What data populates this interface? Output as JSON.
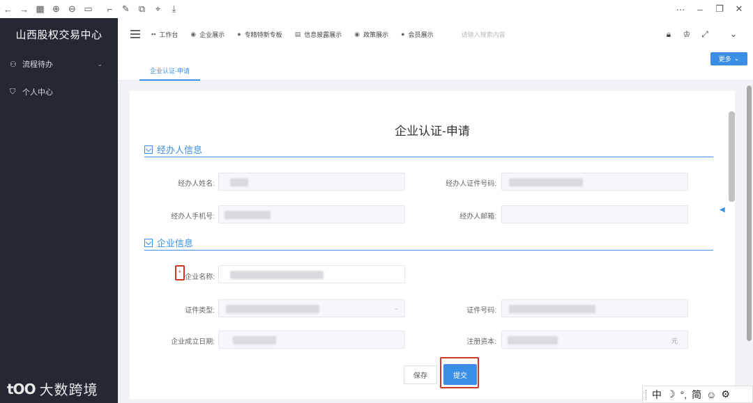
{
  "browser": {
    "icons": [
      "back-icon",
      "forward-icon",
      "apps-icon",
      "zoom-in-icon",
      "zoom-out-icon",
      "fit-icon",
      "crop-icon",
      "edit-icon",
      "copy-icon",
      "screenshot-icon",
      "download-icon"
    ],
    "right_icons": [
      "more-icon",
      "minimize-icon",
      "restore-icon",
      "close-icon"
    ]
  },
  "sidebar": {
    "brand": "山西股权交易中心",
    "items": [
      {
        "label": "流程待办",
        "icon": "flow-icon",
        "has_children": true
      },
      {
        "label": "个人中心",
        "icon": "shield-icon",
        "has_children": false
      }
    ]
  },
  "watermark": {
    "logo": "tOO",
    "text": "大数跨境"
  },
  "topnav": {
    "links": [
      {
        "label": "工作台",
        "icon": "grid-icon"
      },
      {
        "label": "企业展示",
        "icon": "eye-icon"
      },
      {
        "label": "专精特新专板",
        "icon": "user-icon"
      },
      {
        "label": "信息披露展示",
        "icon": "doc-icon"
      },
      {
        "label": "政策展示",
        "icon": "eye-icon"
      },
      {
        "label": "会员展示",
        "icon": "user-icon"
      }
    ],
    "search_placeholder": "请输入搜索内容",
    "right_icons": [
      "lock-icon",
      "shirt-icon",
      "fullscreen-icon",
      "chevron-down-icon"
    ]
  },
  "tabs": {
    "active": "企业认证-申请",
    "more_label": "更多"
  },
  "form": {
    "title": "企业认证-申请",
    "sections": [
      {
        "title": "经办人信息",
        "fields": [
          {
            "label": "经办人姓名:"
          },
          {
            "label": "经办人证件号码:"
          },
          {
            "label": "经办人手机号:"
          },
          {
            "label": "经办人邮箱:"
          }
        ]
      },
      {
        "title": "企业信息",
        "fields": [
          {
            "label": "企业名称:",
            "required_mark": "*"
          },
          {
            "label": "证件类型:"
          },
          {
            "label": "证件号码:"
          },
          {
            "label": "企业成立日期:"
          },
          {
            "label": "注册资本:",
            "unit": "元"
          }
        ]
      }
    ],
    "buttons": {
      "save": "保存",
      "submit": "提交"
    }
  },
  "ime": {
    "items": [
      "中",
      "☽",
      "°,",
      "简",
      "☺",
      "⚙"
    ]
  }
}
